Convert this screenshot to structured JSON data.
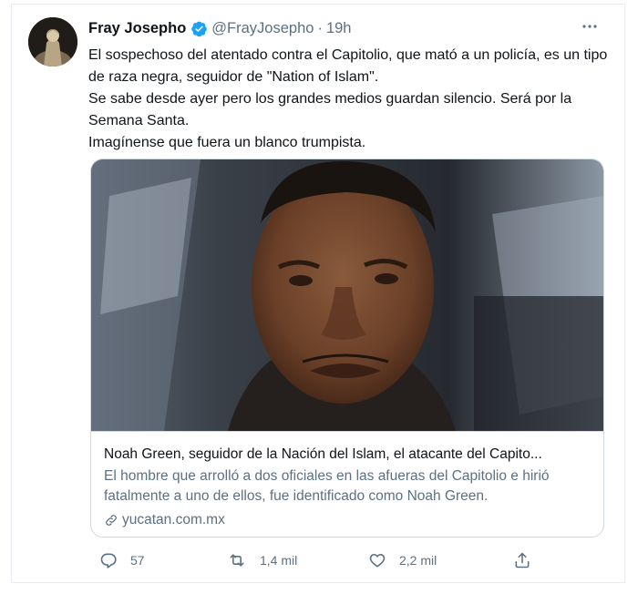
{
  "tweet": {
    "author_name": "Fray Josepho",
    "handle": "@FrayJosepho",
    "separator": "·",
    "time": "19h",
    "text_lines": [
      "El sospechoso del atentado contra el Capitolio, que mató a un policía, es un tipo de raza negra, seguidor de \"Nation of Islam\".",
      "Se sabe desde ayer pero los grandes medios guardan silencio. Será por la Semana Santa.",
      "Imagínense que fuera un blanco trumpista."
    ]
  },
  "link_card": {
    "title": "Noah Green, seguidor de la Nación del Islam, el atacante del Capito...",
    "description": "El hombre que arrolló a dos oficiales en las afueras del Capitolio e hirió fatalmente a uno de ellos, fue identificado como Noah Green.",
    "domain": "yucatan.com.mx"
  },
  "actions": {
    "replies": "57",
    "retweets": "1,4 mil",
    "likes": "2,2 mil"
  },
  "icons": [
    "verified-badge-icon",
    "more-options-icon",
    "link-icon",
    "reply-icon",
    "retweet-icon",
    "like-icon",
    "share-icon"
  ],
  "colors": {
    "verified_blue": "#1da1f2",
    "secondary_text": "#5b7083",
    "border": "#cfd9de"
  }
}
